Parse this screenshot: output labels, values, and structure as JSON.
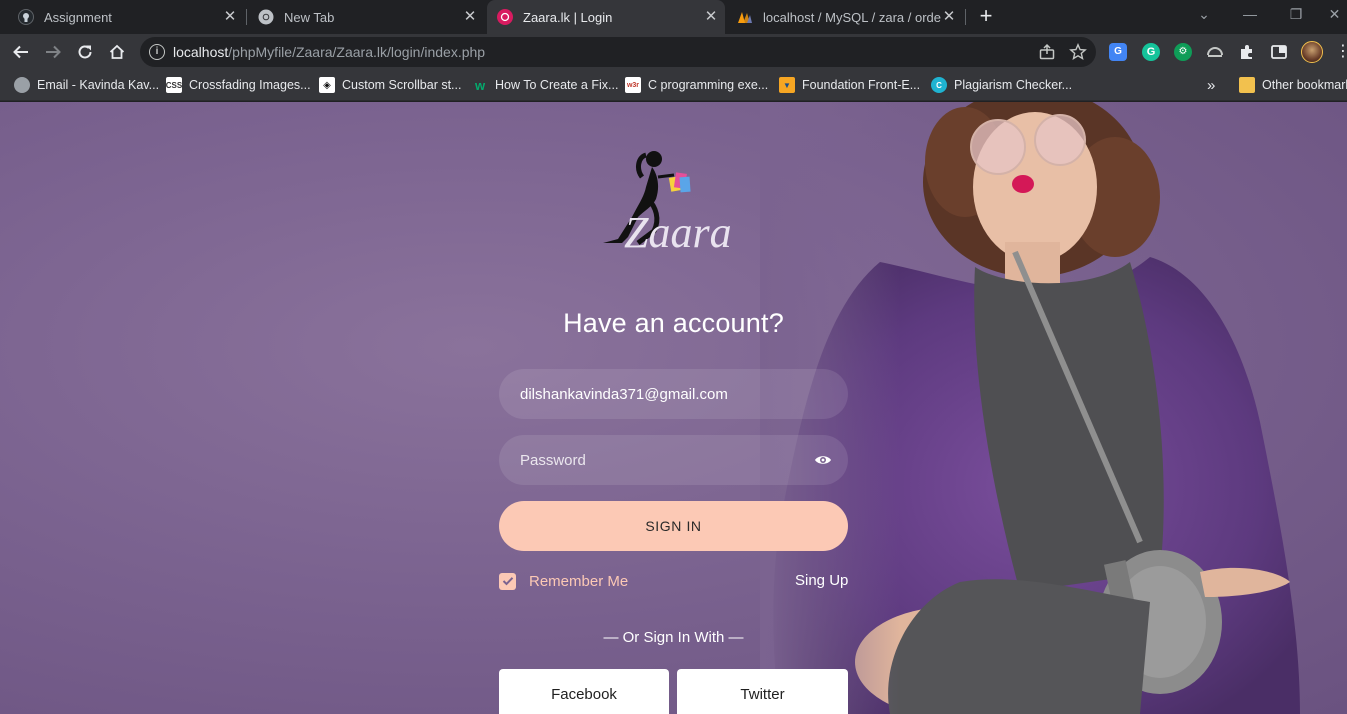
{
  "tabs": [
    {
      "title": "Assignment",
      "icon": "github-icon",
      "active": false
    },
    {
      "title": "New Tab",
      "icon": "chrome-icon",
      "active": false
    },
    {
      "title": "Zaara.lk | Login",
      "icon": "zaara-icon",
      "active": true
    },
    {
      "title": "localhost / MySQL / zara / order_",
      "icon": "phpmyadmin-icon",
      "active": false
    }
  ],
  "toolbar": {
    "url_host": "localhost",
    "url_path": "/phpMyfile/Zaara/Zaara.lk/login/index.php"
  },
  "bookmarks": [
    {
      "label": "Email - Kavinda Kav...",
      "icon": "globe-icon"
    },
    {
      "label": "Crossfading Images...",
      "icon": "css3-icon"
    },
    {
      "label": "Custom Scrollbar st...",
      "icon": "codepen-icon"
    },
    {
      "label": "How To Create a Fix...",
      "icon": "w3schools-icon"
    },
    {
      "label": "C programming exe...",
      "icon": "w3resource-icon"
    },
    {
      "label": "Foundation Front-E...",
      "icon": "foundation-icon"
    },
    {
      "label": "Plagiarism Checker...",
      "icon": "plagiarism-icon"
    }
  ],
  "bookmarks_overflow": "»",
  "other_bookmarks": "Other bookmarks",
  "login": {
    "logo_text": "Zaara",
    "heading": "Have an account?",
    "email_value": "dilshankavinda371@gmail.com",
    "password_placeholder": "Password",
    "signin_label": "SIGN IN",
    "remember_label": "Remember Me",
    "remember_checked": true,
    "signup_label": "Sing Up",
    "or_text": "— Or Sign In With —",
    "facebook_label": "Facebook",
    "twitter_label": "Twitter"
  },
  "colors": {
    "accent": "#fcc9b5",
    "page_bg": "#7b6390",
    "chrome_dark": "#202124",
    "chrome_toolbar": "#35363a"
  }
}
